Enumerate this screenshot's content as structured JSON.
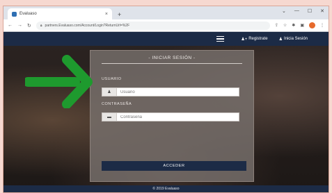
{
  "browser": {
    "tab_title": "Evaluaso",
    "tab_close": "×",
    "new_tab": "+",
    "window_controls": [
      "⌄",
      "—",
      "☐",
      "✕"
    ],
    "nav_back": "←",
    "nav_forward": "→",
    "nav_reload": "↻",
    "url": "partners.Evaluaso.com/Account/Login?ReturnUrl=%2F",
    "colors": {
      "tab_strip": "#dfe3ea",
      "profile": "#e66a2c"
    }
  },
  "navbar": {
    "register_label": "Registrate",
    "login_label": "Inicia Sesión",
    "register_icon": "user-plus-icon",
    "login_icon": "user-icon",
    "color": "#1c2b46"
  },
  "login": {
    "title": "- INICIAR SESIÓN -",
    "user_label": "USUARIO",
    "user_placeholder": "Usuario",
    "user_icon": "user-icon",
    "password_label": "CONTRASEÑA",
    "password_placeholder": "Contraseña",
    "password_icon": "lock-icon",
    "submit_label": "ACCEDER"
  },
  "footer": {
    "text": "© 2019 Evaluaso"
  },
  "annotation": {
    "arrow_color": "#1e9a2e",
    "arrow_icon": "green-arrow-icon"
  }
}
